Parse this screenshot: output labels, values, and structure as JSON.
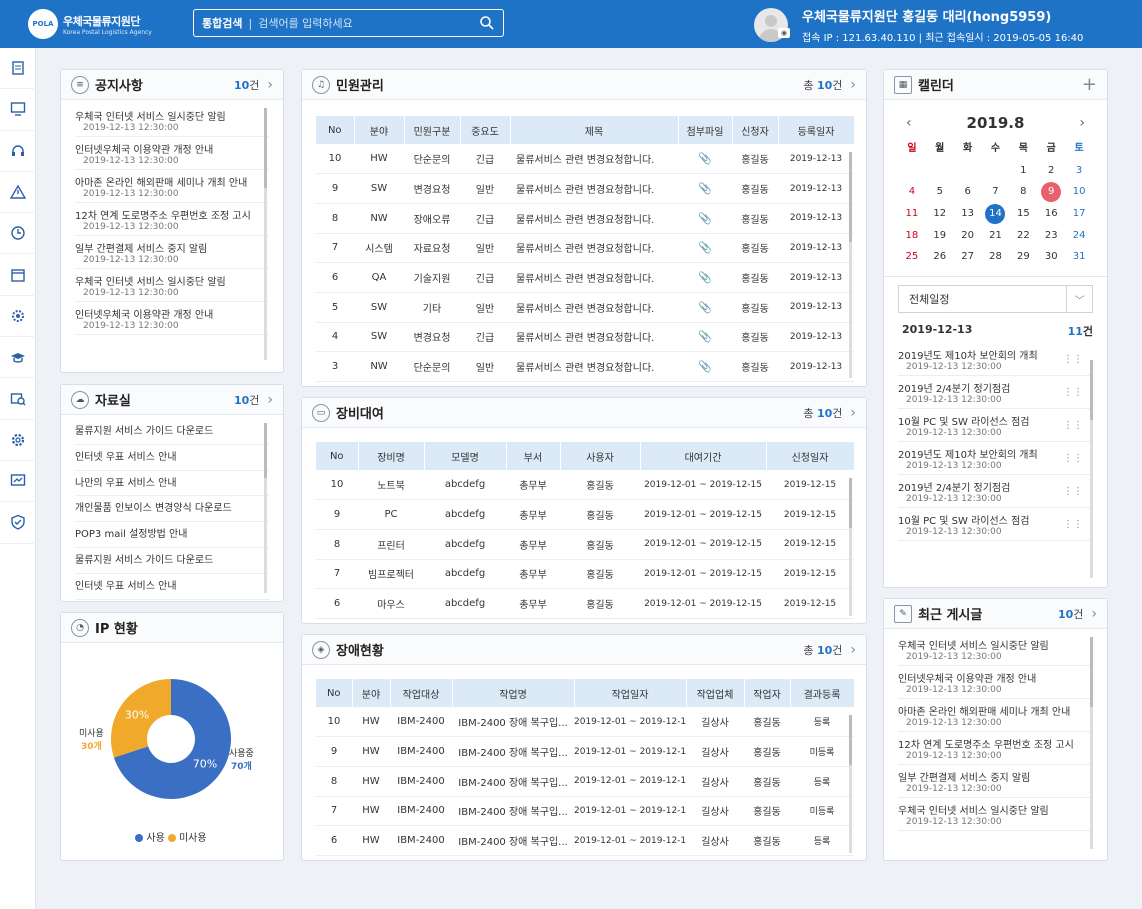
{
  "header": {
    "logo_mark": "POLA",
    "org_title": "우체국물류지원단",
    "org_subtitle": "Korea Postal Logistics Agency",
    "search_label": "통합검색",
    "search_placeholder": "검색어를 입력하세요",
    "user_name": "우체국물류지원단 홍길동 대리(hong5959)",
    "access_ip_label": "접속 IP : 121.63.40.110",
    "last_access_label": "최근 접속일시 : 2019-05-05  16:40"
  },
  "sidebar": {
    "icons": [
      "document-icon",
      "monitor-grid-icon",
      "headset-icon",
      "warning-icon",
      "clock-icon",
      "calendar-icon",
      "gear-network-icon",
      "graduation-icon",
      "book-search-icon",
      "settings-icon",
      "presentation-icon",
      "shield-icon"
    ]
  },
  "notice": {
    "title": "공지사항",
    "count": "10",
    "unit": "건",
    "items": [
      {
        "title": "우체국 인터넷 서비스 일시중단 알림",
        "date": "2019-12-13  12:30:00"
      },
      {
        "title": "인터넷우체국 이용약관 개정 안내",
        "date": "2019-12-13  12:30:00"
      },
      {
        "title": "아마존 온라인 해외판매 세미나 개최 안내",
        "date": "2019-12-13  12:30:00"
      },
      {
        "title": "12차 연계 도로명주소 우편번호 조정 고시",
        "date": "2019-12-13  12:30:00"
      },
      {
        "title": "일부 간편결제 서비스 중지 알림",
        "date": "2019-12-13  12:30:00"
      },
      {
        "title": "우체국 인터넷 서비스 일시중단 알림",
        "date": "2019-12-13  12:30:00"
      },
      {
        "title": "인터넷우체국 이용약관 개정 안내",
        "date": "2019-12-13  12:30:00"
      }
    ]
  },
  "library": {
    "title": "자료실",
    "count": "10",
    "unit": "건",
    "items": [
      "물류지원 서비스 가이드 다운로드",
      "인터넷 우표 서비스 안내",
      "나만의 우표 서비스 안내",
      "개인물품 인보이스 변경양식 다운로드",
      "POP3 mail 설정방법 안내",
      "물류지원 서비스 가이드 다운로드",
      "인터넷 우표 서비스 안내"
    ]
  },
  "ip": {
    "title": "IP 현황",
    "used_pct": "70%",
    "unused_pct": "30%",
    "used_label": "사용중",
    "used_count": "70개",
    "unused_label": "미사용",
    "unused_count": "30개",
    "legend_used": "사용",
    "legend_unused": "미사용",
    "used_color": "#3a6fc4",
    "unused_color": "#f0a92a",
    "used_fraction": 0.7
  },
  "complaints": {
    "title": "민원관리",
    "count_prefix": "총",
    "count": "10",
    "unit": "건",
    "columns": [
      "No",
      "분야",
      "민원구분",
      "중요도",
      "제목",
      "첨부파일",
      "신청자",
      "등록일자"
    ],
    "rows": [
      [
        "10",
        "HW",
        "단순문의",
        "긴급",
        "물류서비스 관련 변경요청합니다.",
        "홍길동",
        "2019-12-13"
      ],
      [
        "9",
        "SW",
        "변경요청",
        "일반",
        "물류서비스 관련 변경요청합니다.",
        "홍길동",
        "2019-12-13"
      ],
      [
        "8",
        "NW",
        "장애오류",
        "긴급",
        "물류서비스 관련 변경요청합니다.",
        "홍길동",
        "2019-12-13"
      ],
      [
        "7",
        "시스템",
        "자료요청",
        "일반",
        "물류서비스 관련 변경요청합니다.",
        "홍길동",
        "2019-12-13"
      ],
      [
        "6",
        "QA",
        "기술지원",
        "긴급",
        "물류서비스 관련 변경요청합니다.",
        "홍길동",
        "2019-12-13"
      ],
      [
        "5",
        "SW",
        "기타",
        "일반",
        "물류서비스 관련 변경요청합니다.",
        "홍길동",
        "2019-12-13"
      ],
      [
        "4",
        "SW",
        "변경요청",
        "긴급",
        "물류서비스 관련 변경요청합니다.",
        "홍길동",
        "2019-12-13"
      ],
      [
        "3",
        "NW",
        "단순문의",
        "일반",
        "물류서비스 관련 변경요청합니다.",
        "홍길동",
        "2019-12-13"
      ]
    ]
  },
  "rental": {
    "title": "장비대여",
    "count_prefix": "총",
    "count": "10",
    "unit": "건",
    "columns": [
      "No",
      "장비명",
      "모델명",
      "부서",
      "사용자",
      "대여기간",
      "신청일자"
    ],
    "rows": [
      [
        "10",
        "노트북",
        "abcdefg",
        "총무부",
        "홍길동",
        "2019-12-01 ~ 2019-12-15",
        "2019-12-15"
      ],
      [
        "9",
        "PC",
        "abcdefg",
        "총무부",
        "홍길동",
        "2019-12-01 ~ 2019-12-15",
        "2019-12-15"
      ],
      [
        "8",
        "프린터",
        "abcdefg",
        "총무부",
        "홍길동",
        "2019-12-01 ~ 2019-12-15",
        "2019-12-15"
      ],
      [
        "7",
        "빔프로젝터",
        "abcdefg",
        "총무부",
        "홍길동",
        "2019-12-01 ~ 2019-12-15",
        "2019-12-15"
      ],
      [
        "6",
        "마우스",
        "abcdefg",
        "총무부",
        "홍길동",
        "2019-12-01 ~ 2019-12-15",
        "2019-12-15"
      ]
    ]
  },
  "failure": {
    "title": "장애현황",
    "count_prefix": "총",
    "count": "10",
    "unit": "건",
    "columns": [
      "No",
      "분야",
      "작업대상",
      "작업명",
      "작업일자",
      "작업업체",
      "작업자",
      "결과등록"
    ],
    "rows": [
      [
        "10",
        "HW",
        "IBM-2400",
        "IBM-2400 장애 복구입...",
        "2019-12-01 ~ 2019-12-15",
        "길상사",
        "홍길동",
        "등록"
      ],
      [
        "9",
        "HW",
        "IBM-2400",
        "IBM-2400 장애 복구입...",
        "2019-12-01 ~ 2019-12-15",
        "길상사",
        "홍길동",
        "미등록"
      ],
      [
        "8",
        "HW",
        "IBM-2400",
        "IBM-2400 장애 복구입...",
        "2019-12-01 ~ 2019-12-15",
        "길상사",
        "홍길동",
        "등록"
      ],
      [
        "7",
        "HW",
        "IBM-2400",
        "IBM-2400 장애 복구입...",
        "2019-12-01 ~ 2019-12-15",
        "길상사",
        "홍길동",
        "미등록"
      ],
      [
        "6",
        "HW",
        "IBM-2400",
        "IBM-2400 장애 복구입...",
        "2019-12-01 ~ 2019-12-15",
        "길상사",
        "홍길동",
        "등록"
      ]
    ]
  },
  "calendar": {
    "title": "캘린더",
    "add": "+",
    "month": "2019.8",
    "prev": "‹",
    "next": "›",
    "weekdays": [
      "일",
      "월",
      "화",
      "수",
      "목",
      "금",
      "토"
    ],
    "weeks": [
      [
        "",
        "",
        "",
        "",
        "1",
        "2",
        "3"
      ],
      [
        "4",
        "5",
        "6",
        "7",
        "8",
        "9",
        "10"
      ],
      [
        "11",
        "12",
        "13",
        "14",
        "15",
        "16",
        "17"
      ],
      [
        "18",
        "19",
        "20",
        "21",
        "22",
        "23",
        "24"
      ],
      [
        "25",
        "26",
        "27",
        "28",
        "29",
        "30",
        "31"
      ]
    ],
    "today": "14",
    "marked": "9",
    "filter_value": "전체일정",
    "selected_date": "2019-12-13",
    "sched_count": "11",
    "sched_unit": "건",
    "schedule": [
      {
        "title": "2019년도 제10차 보안회의 개최",
        "date": "2019-12-13  12:30:00"
      },
      {
        "title": "2019년 2/4분기 정기점검",
        "date": "2019-12-13  12:30:00"
      },
      {
        "title": "10월 PC 및 SW 라이선스 점검",
        "date": "2019-12-13  12:30:00"
      },
      {
        "title": "2019년도 제10차 보안회의 개최",
        "date": "2019-12-13  12:30:00"
      },
      {
        "title": "2019년 2/4분기 정기점검",
        "date": "2019-12-13  12:30:00"
      },
      {
        "title": "10월 PC 및 SW 라이선스 점검",
        "date": "2019-12-13  12:30:00"
      }
    ]
  },
  "recent": {
    "title": "최근 게시글",
    "count": "10",
    "unit": "건",
    "items": [
      {
        "title": "우체국 인터넷 서비스 일시중단 알림",
        "date": "2019-12-13  12:30:00"
      },
      {
        "title": "인터넷우체국 이용약관 개정 안내",
        "date": "2019-12-13  12:30:00"
      },
      {
        "title": "아마존 온라인 해외판매 세미나 개최 안내",
        "date": "2019-12-13  12:30:00"
      },
      {
        "title": "12차 연계 도로명주소 우편번호 조정 고시",
        "date": "2019-12-13  12:30:00"
      },
      {
        "title": "일부 간편결제 서비스 중지 알림",
        "date": "2019-12-13  12:30:00"
      },
      {
        "title": "우체국 인터넷 서비스 일시중단 알림",
        "date": "2019-12-13  12:30:00"
      }
    ]
  }
}
